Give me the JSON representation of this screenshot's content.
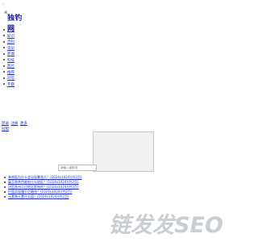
{
  "topmark": "○",
  "logo": {
    "mark": "※",
    "text": "独钓网"
  },
  "nav": {
    "items": [
      "首页",
      "知识",
      "百科",
      "资讯",
      "新闻",
      "科技",
      "图片",
      "推荐",
      "问答",
      "专题"
    ]
  },
  "utility": {
    "links": [
      "登录",
      "注册",
      "更多"
    ],
    "second": "投稿"
  },
  "search": {
    "placeholder": "请输入搜索词"
  },
  "articles": [
    "券商股为什么会出现暴涨大？(1024x1024)(共2页)",
    "蔓苔和茶色能吃什么地区？(1024x1024)(共2页)",
    "决定苏州二位地区影响的？(1024x1024)(共2页)",
    "价值实现赚千亿最伟？(1024x1024)(共2页)",
    "元素和元素什么值？(1024x1024)(共2页)"
  ],
  "watermark": {
    "text": "链发发SEO",
    "color": "#c9ced3"
  }
}
